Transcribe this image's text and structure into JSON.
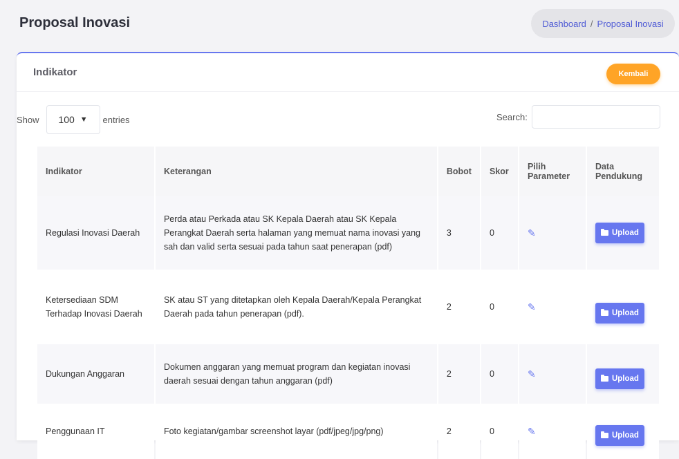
{
  "header": {
    "title": "Proposal Inovasi",
    "breadcrumb": [
      "Dashboard",
      "Proposal Inovasi"
    ]
  },
  "card": {
    "title": "Indikator",
    "back_label": "Kembali"
  },
  "controls": {
    "show_label": "Show",
    "entries_value": "100",
    "entries_label": "entries",
    "search_label": "Search:",
    "search_value": ""
  },
  "table": {
    "columns": [
      "Indikator",
      "Keterangan",
      "Bobot",
      "Skor",
      "Pilih Parameter",
      "Data Pendukung"
    ],
    "rows": [
      {
        "indikator": "Regulasi Inovasi Daerah",
        "keterangan": "Perda atau Perkada atau SK Kepala Daerah atau SK Kepala Perangkat Daerah serta halaman yang memuat nama inovasi yang sah dan valid serta sesuai pada tahun saat penerapan (pdf)",
        "bobot": "3",
        "skor": "0",
        "upload": "Upload"
      },
      {
        "indikator": "Ketersediaan SDM Terhadap Inovasi Daerah",
        "keterangan": "SK atau ST yang ditetapkan oleh Kepala Daerah/Kepala Perangkat Daerah pada tahun penerapan (pdf).",
        "bobot": "2",
        "skor": "0",
        "upload": "Upload"
      },
      {
        "indikator": "Dukungan Anggaran",
        "keterangan": "Dokumen anggaran yang memuat program dan kegiatan inovasi daerah sesuai dengan tahun anggaran (pdf)",
        "bobot": "2",
        "skor": "0",
        "upload": "Upload"
      },
      {
        "indikator": "Penggunaan IT",
        "keterangan": "Foto kegiatan/gambar screenshot layar (pdf/jpeg/jpg/png)",
        "bobot": "2",
        "skor": "0",
        "upload": "Upload"
      }
    ]
  },
  "icons": {
    "edit": "pencil-icon",
    "upload": "folder-icon",
    "select": "chevron-down-icon"
  },
  "colors": {
    "primary": "#6777ef",
    "warning": "#ffa426"
  }
}
